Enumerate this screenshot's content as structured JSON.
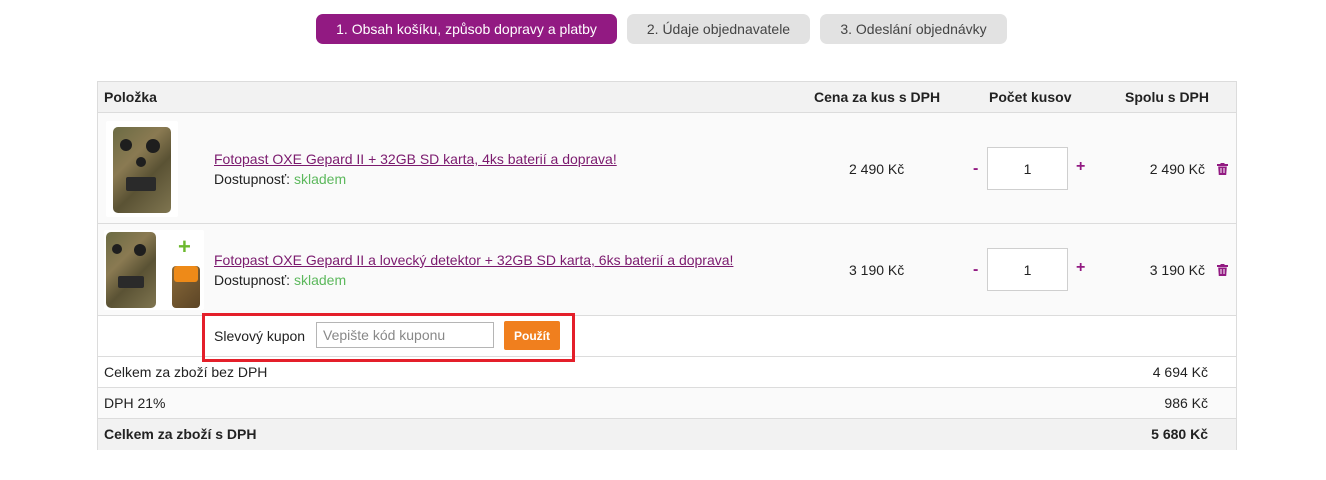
{
  "steps": [
    {
      "label": "1. Obsah košíku, způsob dopravy a platby"
    },
    {
      "label": "2. Údaje objednavatele"
    },
    {
      "label": "3. Odeslání objednávky"
    }
  ],
  "table": {
    "headers": {
      "item": "Položka",
      "unit_price": "Cena za kus s DPH",
      "quantity": "Počet kusov",
      "total": "Spolu s DPH"
    },
    "items": [
      {
        "name": "Fotopast OXE Gepard II + 32GB SD karta, 4ks baterií a doprava!",
        "availability_label": "Dostupnosť:",
        "availability_value": "skladem",
        "unit_price": "2 490 Kč",
        "quantity": "1",
        "total": "2 490 Kč",
        "image": "camera-trap-image"
      },
      {
        "name": "Fotopast OXE Gepard II a lovecký detektor + 32GB SD karta, 6ks baterií a doprava!",
        "availability_label": "Dostupnosť:",
        "availability_value": "skladem",
        "unit_price": "3 190 Kč",
        "quantity": "1",
        "total": "3 190 Kč",
        "image": "camera-trap-with-detector-image"
      }
    ],
    "qty_minus": "-",
    "qty_plus": "+"
  },
  "coupon": {
    "label": "Slevový kupon",
    "placeholder": "Vepište kód kuponu",
    "button": "Použít"
  },
  "summary": [
    {
      "label": "Celkem za zboží bez DPH",
      "value": "4 694 Kč"
    },
    {
      "label": "DPH 21%",
      "value": "986 Kč"
    },
    {
      "label": "Celkem za zboží s DPH",
      "value": "5 680 Kč"
    }
  ],
  "colors": {
    "accent": "#921a82",
    "inactive_step": "#e2e2e2",
    "stock_green": "#5cb85c",
    "coupon_button": "#f07f1e",
    "highlight_box": "#e41f2a"
  }
}
